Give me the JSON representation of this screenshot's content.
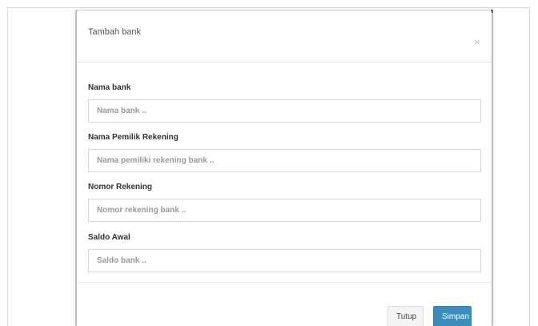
{
  "modal": {
    "title": "Tambah bank",
    "close_symbol": "×",
    "close_icon": "close-icon"
  },
  "form": {
    "fields": [
      {
        "label": "Nama bank",
        "placeholder": "Nama bank ..",
        "value": ""
      },
      {
        "label": "Nama Pemilik Rekening",
        "placeholder": "Nama pemiliki rekening bank ..",
        "value": ""
      },
      {
        "label": "Nomor Rekening",
        "placeholder": "Nomor rekening bank ..",
        "value": ""
      },
      {
        "label": "Saldo Awal",
        "placeholder": "Saldo bank ..",
        "value": ""
      }
    ]
  },
  "footer": {
    "close_label": "Tutup",
    "save_label": "Simpan"
  },
  "colors": {
    "primary": "#3c8dbc",
    "default_button": "#f4f4f4",
    "input_border": "#d2d6de",
    "backdrop": "#cfd3d6"
  }
}
